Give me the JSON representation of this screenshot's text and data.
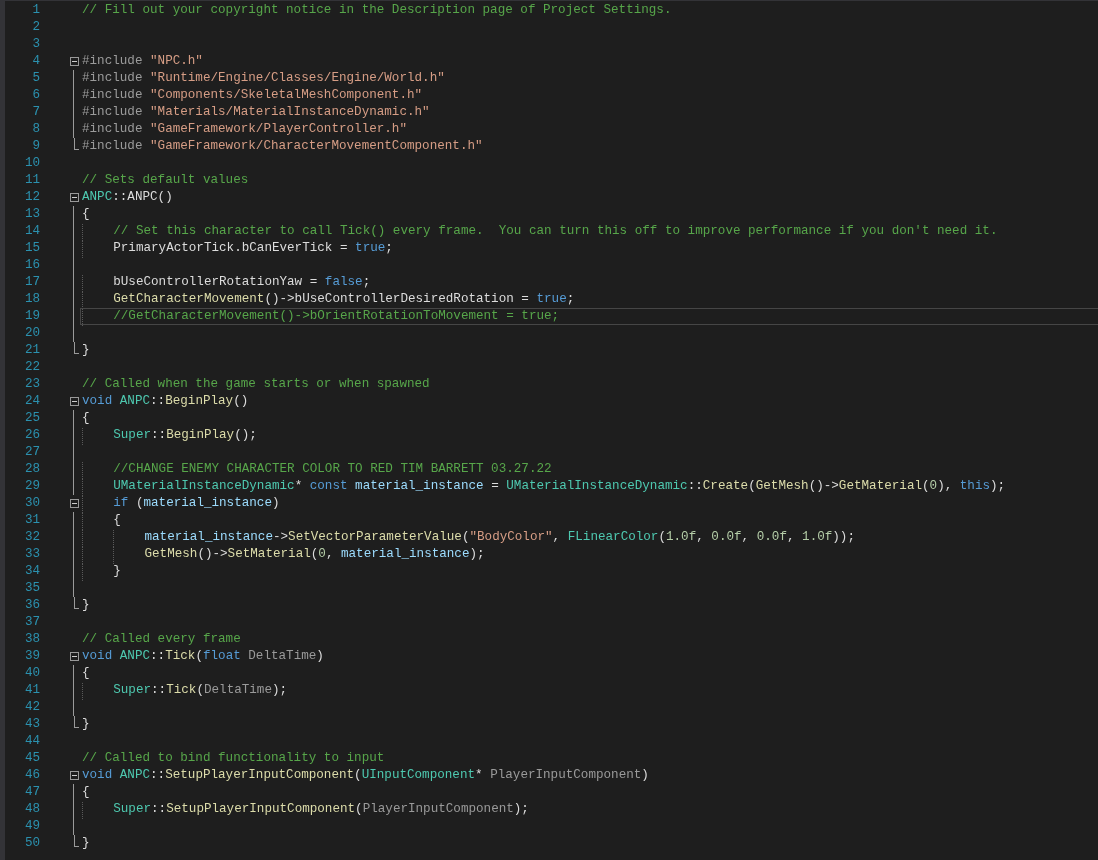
{
  "editor": {
    "lines": [
      {
        "number": "1",
        "selected": false,
        "tokens": [
          {
            "kind": "comment",
            "text": "// Fill out your copyright notice in the Description page of Project Settings."
          }
        ]
      },
      {
        "number": "2",
        "selected": false
      },
      {
        "number": "3",
        "selected": false
      },
      {
        "number": "4",
        "kind": "fold-start",
        "expanded": true,
        "selected": false,
        "tokens": [
          {
            "kind": "directive",
            "text": "#include"
          },
          {
            "kind": "string",
            "text": " \"NPC.h\""
          }
        ]
      },
      {
        "number": "5",
        "kind": "fold-body",
        "selected": false,
        "tokens": [
          {
            "kind": "directive",
            "text": "#include"
          },
          {
            "kind": "string",
            "text": " \"Runtime/Engine/Classes/Engine/World.h\""
          }
        ]
      },
      {
        "number": "6",
        "kind": "fold-body",
        "selected": false,
        "tokens": [
          {
            "kind": "directive",
            "text": "#include"
          },
          {
            "kind": "string",
            "text": " \"Components/SkeletalMeshComponent.h\""
          }
        ]
      },
      {
        "number": "7",
        "kind": "fold-body",
        "selected": false,
        "tokens": [
          {
            "kind": "directive",
            "text": "#include"
          },
          {
            "kind": "string",
            "text": " \"Materials/MaterialInstanceDynamic.h\""
          }
        ]
      },
      {
        "number": "8",
        "kind": "fold-body",
        "selected": false,
        "tokens": [
          {
            "kind": "directive",
            "text": "#include"
          },
          {
            "kind": "string",
            "text": " \"GameFramework/PlayerController.h\""
          }
        ]
      },
      {
        "number": "9",
        "kind": "fold-end",
        "selected": false,
        "tokens": [
          {
            "kind": "directive",
            "text": "#include"
          },
          {
            "kind": "string",
            "text": " \"GameFramework/CharacterMovementComponent.h\""
          }
        ]
      },
      {
        "number": "10",
        "selected": false
      },
      {
        "number": "11",
        "selected": false,
        "tokens": [
          {
            "kind": "comment",
            "text": "// Sets default values"
          }
        ]
      },
      {
        "number": "12",
        "kind": "fold-start",
        "expanded": true,
        "selected": false,
        "tokens": [
          {
            "kind": "type",
            "text": "ANPC"
          },
          {
            "kind": "plain",
            "text": "::"
          },
          {
            "kind": "plain",
            "text": "ANPC()"
          }
        ]
      },
      {
        "number": "13",
        "kind": "fold-body",
        "selected": false,
        "tokens": [
          {
            "kind": "plain",
            "text": "{"
          }
        ]
      },
      {
        "number": "14",
        "kind": "fold-body",
        "selected": false,
        "tokens": [
          {
            "kind": "comment",
            "text": "    // Set this character to call Tick() every frame.  You can turn this off to improve performance if you don't need it."
          }
        ]
      },
      {
        "number": "15",
        "kind": "fold-body",
        "selected": false,
        "tokens": [
          {
            "kind": "plain",
            "text": "    PrimaryActorTick.bCanEverTick = "
          },
          {
            "kind": "keyword",
            "text": "true"
          },
          {
            "kind": "plain",
            "text": ";"
          }
        ]
      },
      {
        "number": "16",
        "kind": "fold-body",
        "selected": false
      },
      {
        "number": "17",
        "kind": "fold-body",
        "selected": false,
        "tokens": [
          {
            "kind": "plain",
            "text": "    bUseControllerRotationYaw = "
          },
          {
            "kind": "keyword",
            "text": "false"
          },
          {
            "kind": "plain",
            "text": ";"
          }
        ]
      },
      {
        "number": "18",
        "kind": "fold-body",
        "selected": false,
        "tokens": [
          {
            "kind": "function",
            "text": "    GetCharacterMovement"
          },
          {
            "kind": "plain",
            "text": "()->bUseControllerDesiredRotation = "
          },
          {
            "kind": "keyword",
            "text": "true"
          },
          {
            "kind": "plain",
            "text": ";"
          }
        ]
      },
      {
        "number": "19",
        "kind": "fold-body",
        "selected": true,
        "tokens": [
          {
            "kind": "comment",
            "text": "    //GetCharacterMovement()->bOrientRotationToMovement = true;"
          }
        ]
      },
      {
        "number": "20",
        "kind": "fold-body",
        "selected": false
      },
      {
        "number": "21",
        "kind": "fold-end",
        "selected": false,
        "tokens": [
          {
            "kind": "plain",
            "text": "}"
          }
        ]
      },
      {
        "number": "22",
        "selected": false
      },
      {
        "number": "23",
        "selected": false,
        "tokens": [
          {
            "kind": "comment",
            "text": "// Called when the game starts or when spawned"
          }
        ]
      },
      {
        "number": "24",
        "kind": "fold-start",
        "expanded": true,
        "selected": false,
        "tokens": [
          {
            "kind": "keyword",
            "text": "void"
          },
          {
            "kind": "type",
            "text": " ANPC"
          },
          {
            "kind": "plain",
            "text": "::"
          },
          {
            "kind": "function",
            "text": "BeginPlay"
          },
          {
            "kind": "plain",
            "text": "()"
          }
        ]
      },
      {
        "number": "25",
        "kind": "fold-body",
        "selected": false,
        "tokens": [
          {
            "kind": "plain",
            "text": "{"
          }
        ]
      },
      {
        "number": "26",
        "kind": "fold-body",
        "selected": false,
        "tokens": [
          {
            "kind": "type",
            "text": "    Super"
          },
          {
            "kind": "plain",
            "text": "::"
          },
          {
            "kind": "function",
            "text": "BeginPlay"
          },
          {
            "kind": "plain",
            "text": "();"
          }
        ]
      },
      {
        "number": "27",
        "kind": "fold-body",
        "selected": false
      },
      {
        "number": "28",
        "kind": "fold-body",
        "selected": false,
        "tokens": [
          {
            "kind": "comment",
            "text": "    //CHANGE ENEMY CHARACTER COLOR TO RED TIM BARRETT 03.27.22"
          }
        ]
      },
      {
        "number": "29",
        "kind": "fold-body",
        "selected": false,
        "tokens": [
          {
            "kind": "type",
            "text": "    UMaterialInstanceDynamic"
          },
          {
            "kind": "plain",
            "text": "* "
          },
          {
            "kind": "keyword",
            "text": "const"
          },
          {
            "kind": "variable",
            "text": " material_instance"
          },
          {
            "kind": "plain",
            "text": " = "
          },
          {
            "kind": "type",
            "text": "UMaterialInstanceDynamic"
          },
          {
            "kind": "plain",
            "text": "::"
          },
          {
            "kind": "function",
            "text": "Create"
          },
          {
            "kind": "plain",
            "text": "("
          },
          {
            "kind": "function",
            "text": "GetMesh"
          },
          {
            "kind": "plain",
            "text": "()->"
          },
          {
            "kind": "function",
            "text": "GetMaterial"
          },
          {
            "kind": "plain",
            "text": "("
          },
          {
            "kind": "number",
            "text": "0"
          },
          {
            "kind": "plain",
            "text": "), "
          },
          {
            "kind": "keyword",
            "text": "this"
          },
          {
            "kind": "plain",
            "text": ");"
          }
        ]
      },
      {
        "number": "30",
        "kind": "fold-start",
        "expanded": true,
        "selected": false,
        "tokens": [
          {
            "kind": "keyword",
            "text": "    if"
          },
          {
            "kind": "plain",
            "text": " ("
          },
          {
            "kind": "variable",
            "text": "material_instance"
          },
          {
            "kind": "plain",
            "text": ")"
          }
        ]
      },
      {
        "number": "31",
        "kind": "fold-body",
        "selected": false,
        "tokens": [
          {
            "kind": "plain",
            "text": "    {"
          }
        ]
      },
      {
        "number": "32",
        "kind": "fold-body",
        "selected": false,
        "tokens": [
          {
            "kind": "variable",
            "text": "        material_instance"
          },
          {
            "kind": "plain",
            "text": "->"
          },
          {
            "kind": "function",
            "text": "SetVectorParameterValue"
          },
          {
            "kind": "plain",
            "text": "("
          },
          {
            "kind": "string",
            "text": "\"BodyColor\""
          },
          {
            "kind": "plain",
            "text": ", "
          },
          {
            "kind": "type",
            "text": "FLinearColor"
          },
          {
            "kind": "plain",
            "text": "("
          },
          {
            "kind": "number",
            "text": "1.0f"
          },
          {
            "kind": "plain",
            "text": ", "
          },
          {
            "kind": "number",
            "text": "0.0f"
          },
          {
            "kind": "plain",
            "text": ", "
          },
          {
            "kind": "number",
            "text": "0.0f"
          },
          {
            "kind": "plain",
            "text": ", "
          },
          {
            "kind": "number",
            "text": "1.0f"
          },
          {
            "kind": "plain",
            "text": "));"
          }
        ]
      },
      {
        "number": "33",
        "kind": "fold-body",
        "selected": false,
        "tokens": [
          {
            "kind": "function",
            "text": "        GetMesh"
          },
          {
            "kind": "plain",
            "text": "()->"
          },
          {
            "kind": "function",
            "text": "SetMaterial"
          },
          {
            "kind": "plain",
            "text": "("
          },
          {
            "kind": "number",
            "text": "0"
          },
          {
            "kind": "plain",
            "text": ", "
          },
          {
            "kind": "variable",
            "text": "material_instance"
          },
          {
            "kind": "plain",
            "text": ");"
          }
        ]
      },
      {
        "number": "34",
        "kind": "fold-body",
        "selected": false,
        "tokens": [
          {
            "kind": "plain",
            "text": "    }"
          }
        ]
      },
      {
        "number": "35",
        "kind": "fold-body",
        "selected": false
      },
      {
        "number": "36",
        "kind": "fold-end",
        "selected": false,
        "tokens": [
          {
            "kind": "plain",
            "text": "}"
          }
        ]
      },
      {
        "number": "37",
        "selected": false
      },
      {
        "number": "38",
        "selected": false,
        "tokens": [
          {
            "kind": "comment",
            "text": "// Called every frame"
          }
        ]
      },
      {
        "number": "39",
        "kind": "fold-start",
        "expanded": true,
        "selected": false,
        "tokens": [
          {
            "kind": "keyword",
            "text": "void"
          },
          {
            "kind": "type",
            "text": " ANPC"
          },
          {
            "kind": "plain",
            "text": "::"
          },
          {
            "kind": "function",
            "text": "Tick"
          },
          {
            "kind": "plain",
            "text": "("
          },
          {
            "kind": "keyword",
            "text": "float"
          },
          {
            "kind": "param",
            "text": " DeltaTime"
          },
          {
            "kind": "plain",
            "text": ")"
          }
        ]
      },
      {
        "number": "40",
        "kind": "fold-body",
        "selected": false,
        "tokens": [
          {
            "kind": "plain",
            "text": "{"
          }
        ]
      },
      {
        "number": "41",
        "kind": "fold-body",
        "selected": false,
        "tokens": [
          {
            "kind": "type",
            "text": "    Super"
          },
          {
            "kind": "plain",
            "text": "::"
          },
          {
            "kind": "function",
            "text": "Tick"
          },
          {
            "kind": "plain",
            "text": "("
          },
          {
            "kind": "param",
            "text": "DeltaTime"
          },
          {
            "kind": "plain",
            "text": ");"
          }
        ]
      },
      {
        "number": "42",
        "kind": "fold-body",
        "selected": false
      },
      {
        "number": "43",
        "kind": "fold-end",
        "selected": false,
        "tokens": [
          {
            "kind": "plain",
            "text": "}"
          }
        ]
      },
      {
        "number": "44",
        "selected": false
      },
      {
        "number": "45",
        "selected": false,
        "tokens": [
          {
            "kind": "comment",
            "text": "// Called to bind functionality to input"
          }
        ]
      },
      {
        "number": "46",
        "kind": "fold-start",
        "expanded": true,
        "selected": false,
        "tokens": [
          {
            "kind": "keyword",
            "text": "void"
          },
          {
            "kind": "type",
            "text": " ANPC"
          },
          {
            "kind": "plain",
            "text": "::"
          },
          {
            "kind": "function",
            "text": "SetupPlayerInputComponent"
          },
          {
            "kind": "plain",
            "text": "("
          },
          {
            "kind": "type",
            "text": "UInputComponent"
          },
          {
            "kind": "plain",
            "text": "* "
          },
          {
            "kind": "param",
            "text": "PlayerInputComponent"
          },
          {
            "kind": "plain",
            "text": ")"
          }
        ]
      },
      {
        "number": "47",
        "kind": "fold-body",
        "selected": false,
        "tokens": [
          {
            "kind": "plain",
            "text": "{"
          }
        ]
      },
      {
        "number": "48",
        "kind": "fold-body",
        "selected": false,
        "tokens": [
          {
            "kind": "type",
            "text": "    Super"
          },
          {
            "kind": "plain",
            "text": "::"
          },
          {
            "kind": "function",
            "text": "SetupPlayerInputComponent"
          },
          {
            "kind": "plain",
            "text": "("
          },
          {
            "kind": "param",
            "text": "PlayerInputComponent"
          },
          {
            "kind": "plain",
            "text": ");"
          }
        ]
      },
      {
        "number": "49",
        "kind": "fold-body",
        "selected": false
      },
      {
        "number": "50",
        "kind": "fold-end",
        "selected": false,
        "tokens": [
          {
            "kind": "plain",
            "text": "}"
          }
        ]
      }
    ]
  }
}
